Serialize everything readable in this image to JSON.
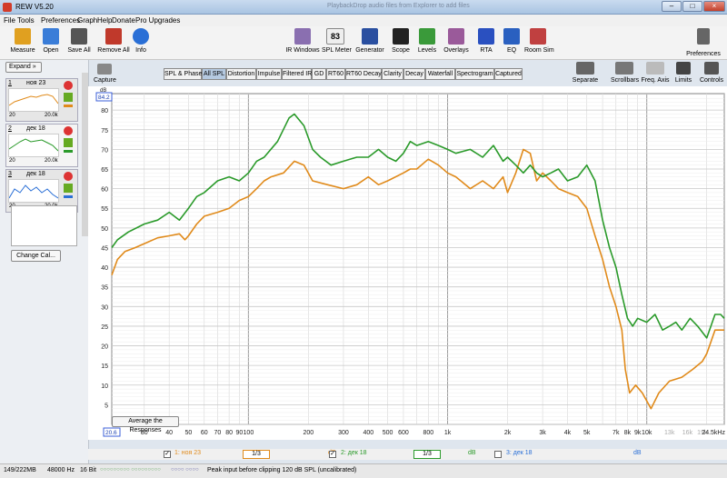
{
  "window": {
    "title": "REW V5.20",
    "blurred_title": "PlaybackDrop audio files from Explorer to add files"
  },
  "menu": [
    "File",
    "Tools",
    "Preferences",
    "Graph",
    "Help",
    "Donate",
    "Pro Upgrades"
  ],
  "toolbar": {
    "left": [
      {
        "label": "Measure",
        "icon": "microphone-icon",
        "color": "#e0a020"
      },
      {
        "label": "Open",
        "icon": "folder-icon",
        "color": "#3a7dd8"
      },
      {
        "label": "Save All",
        "icon": "floppy-icon",
        "color": "#555555"
      },
      {
        "label": "Remove All",
        "icon": "remove-icon",
        "color": "#c0392b"
      },
      {
        "label": "Info",
        "icon": "info-icon",
        "color": "#2a6fd6"
      }
    ],
    "center": [
      {
        "label": "IR Windows",
        "icon": "ir-windows-icon",
        "color": "#8a6fb0"
      },
      {
        "label": "SPL Meter",
        "icon": "spl-meter-icon",
        "value": "83",
        "unit": "dB SPL",
        "color": "#333333"
      },
      {
        "label": "Generator",
        "icon": "generator-icon",
        "color": "#2a4fa0"
      },
      {
        "label": "Scope",
        "icon": "scope-icon",
        "color": "#222222"
      },
      {
        "label": "Levels",
        "icon": "levels-icon",
        "color": "#3a9a3a"
      },
      {
        "label": "Overlays",
        "icon": "overlays-icon",
        "color": "#9a5a9a"
      },
      {
        "label": "RTA",
        "icon": "rta-icon",
        "color": "#2a50c0"
      },
      {
        "label": "EQ",
        "icon": "eq-icon",
        "color": "#2a60c0"
      },
      {
        "label": "Room Sim",
        "icon": "room-sim-icon",
        "color": "#c04040"
      }
    ],
    "preferences": {
      "label": "Preferences",
      "icon": "wrench-icon"
    }
  },
  "left_panel": {
    "expand_label": "Expand",
    "measurements": [
      {
        "num": "1",
        "date": "ноя 23",
        "color": "#e08a1a",
        "axis_start": "20",
        "axis_end": "20.0k"
      },
      {
        "num": "2",
        "date": "дек 18",
        "color": "#2a9a2a",
        "axis_start": "20",
        "axis_end": "20.0k"
      },
      {
        "num": "3",
        "date": "дек 18",
        "color": "#2a6fd6",
        "axis_start": "20",
        "axis_end": "20.0k"
      }
    ],
    "change_cal_label": "Change Cal..."
  },
  "capture_label": "Capture",
  "tabs": [
    "SPL & Phase",
    "All SPL",
    "Distortion",
    "Impulse",
    "Filtered IR",
    "GD",
    "RT60",
    "RT60 Decay",
    "Clarity",
    "Decay",
    "Waterfall",
    "Spectrogram",
    "Captured"
  ],
  "active_tab": "All SPL",
  "right_tools": [
    {
      "label": "Separate",
      "icon": "separate-icon"
    },
    {
      "label": "Scrollbars",
      "icon": "scrollbars-icon"
    },
    {
      "label": "Freq. Axis",
      "icon": "freq-axis-icon"
    },
    {
      "label": "Limits",
      "icon": "limits-icon"
    },
    {
      "label": "Controls",
      "icon": "controls-icon"
    }
  ],
  "graph": {
    "y_unit": "dB",
    "y_top_box": "84.2",
    "x_start_box": "20.6",
    "x_end_label": "24.5kHz",
    "average_button": "Average the Responses"
  },
  "legend": {
    "items": [
      {
        "checked": true,
        "name": "1: ноя 23",
        "smoothing": "1/3",
        "unit": "dB",
        "color": "#e08a1a"
      },
      {
        "checked": true,
        "name": "2: дек 18",
        "smoothing": "1/3",
        "unit": "dB",
        "color": "#2a9a2a"
      },
      {
        "checked": false,
        "name": "3: дек 18",
        "smoothing": "",
        "unit": "dB",
        "color": "#2a6fd6"
      }
    ]
  },
  "status": {
    "memory": "149/222MB",
    "sample_rate": "48000 Hz",
    "bits": "16 Bit",
    "clip_warning": "Peak input before clipping 120 dB SPL (uncalibrated)"
  },
  "chart_data": {
    "type": "line",
    "title": "",
    "xlabel": "",
    "ylabel": "dB",
    "x_scale": "log",
    "xlim": [
      20.6,
      24500
    ],
    "ylim": [
      0,
      84.2
    ],
    "grid": true,
    "x_tick_labels": [
      {
        "f": 20.6,
        "label": "20.6",
        "dim": false
      },
      {
        "f": 30,
        "label": "30",
        "dim": false
      },
      {
        "f": 40,
        "label": "40",
        "dim": false
      },
      {
        "f": 50,
        "label": "50",
        "dim": false
      },
      {
        "f": 60,
        "label": "60",
        "dim": false
      },
      {
        "f": 70,
        "label": "70",
        "dim": false
      },
      {
        "f": 80,
        "label": "80",
        "dim": false
      },
      {
        "f": 90,
        "label": "90",
        "dim": false
      },
      {
        "f": 100,
        "label": "100",
        "dim": false
      },
      {
        "f": 200,
        "label": "200",
        "dim": false
      },
      {
        "f": 300,
        "label": "300",
        "dim": false
      },
      {
        "f": 400,
        "label": "400",
        "dim": false
      },
      {
        "f": 500,
        "label": "500",
        "dim": false
      },
      {
        "f": 600,
        "label": "600",
        "dim": false
      },
      {
        "f": 800,
        "label": "800",
        "dim": false
      },
      {
        "f": 1000,
        "label": "1k",
        "dim": false
      },
      {
        "f": 2000,
        "label": "2k",
        "dim": false
      },
      {
        "f": 3000,
        "label": "3k",
        "dim": false
      },
      {
        "f": 4000,
        "label": "4k",
        "dim": false
      },
      {
        "f": 5000,
        "label": "5k",
        "dim": false
      },
      {
        "f": 7000,
        "label": "7k",
        "dim": false
      },
      {
        "f": 8000,
        "label": "8k",
        "dim": false
      },
      {
        "f": 9000,
        "label": "9k",
        "dim": false
      },
      {
        "f": 10000,
        "label": "10k",
        "dim": false
      },
      {
        "f": 13000,
        "label": "13k",
        "dim": true
      },
      {
        "f": 16000,
        "label": "16k",
        "dim": true
      },
      {
        "f": 19000,
        "label": "19k",
        "dim": true
      },
      {
        "f": 24500,
        "label": "24.5kHz",
        "dim": false
      }
    ],
    "y_ticks": [
      80,
      75,
      70,
      65,
      60,
      55,
      50,
      45,
      40,
      35,
      30,
      25,
      20,
      15,
      10,
      5
    ],
    "series": [
      {
        "name": "1: ноя 23",
        "color": "#e08a1a",
        "points": [
          [
            20.6,
            38
          ],
          [
            22,
            42
          ],
          [
            24,
            44
          ],
          [
            27,
            45
          ],
          [
            30,
            46
          ],
          [
            35,
            47.5
          ],
          [
            40,
            48
          ],
          [
            45,
            48.5
          ],
          [
            48,
            47
          ],
          [
            50,
            48
          ],
          [
            55,
            51
          ],
          [
            60,
            53
          ],
          [
            70,
            54
          ],
          [
            80,
            55
          ],
          [
            90,
            57
          ],
          [
            100,
            58
          ],
          [
            110,
            60
          ],
          [
            120,
            62
          ],
          [
            130,
            63
          ],
          [
            150,
            64
          ],
          [
            170,
            67
          ],
          [
            190,
            66
          ],
          [
            210,
            62
          ],
          [
            250,
            61
          ],
          [
            300,
            60
          ],
          [
            350,
            61
          ],
          [
            400,
            63
          ],
          [
            450,
            61
          ],
          [
            500,
            62
          ],
          [
            600,
            64
          ],
          [
            650,
            65
          ],
          [
            700,
            65
          ],
          [
            800,
            67.5
          ],
          [
            900,
            66
          ],
          [
            1000,
            64
          ],
          [
            1100,
            63
          ],
          [
            1300,
            60
          ],
          [
            1500,
            62
          ],
          [
            1700,
            60
          ],
          [
            1900,
            63
          ],
          [
            2000,
            59
          ],
          [
            2200,
            64
          ],
          [
            2400,
            70
          ],
          [
            2600,
            69
          ],
          [
            2800,
            62
          ],
          [
            3000,
            64
          ],
          [
            3300,
            62
          ],
          [
            3600,
            60
          ],
          [
            4000,
            59
          ],
          [
            4500,
            58
          ],
          [
            5000,
            55
          ],
          [
            5500,
            48
          ],
          [
            6000,
            42
          ],
          [
            6500,
            35
          ],
          [
            7000,
            30
          ],
          [
            7500,
            24
          ],
          [
            7800,
            14
          ],
          [
            8200,
            8
          ],
          [
            8800,
            10
          ],
          [
            9500,
            8
          ],
          [
            10500,
            4
          ],
          [
            11500,
            8
          ],
          [
            13000,
            11
          ],
          [
            15000,
            12
          ],
          [
            17000,
            14
          ],
          [
            19000,
            16
          ],
          [
            20000,
            18
          ],
          [
            21000,
            21
          ],
          [
            22000,
            24
          ],
          [
            23500,
            24
          ],
          [
            24500,
            24
          ]
        ]
      },
      {
        "name": "2: дек 18",
        "color": "#2a9a2a",
        "points": [
          [
            20.6,
            45
          ],
          [
            22,
            47
          ],
          [
            25,
            49
          ],
          [
            30,
            51
          ],
          [
            35,
            52
          ],
          [
            40,
            54
          ],
          [
            45,
            52
          ],
          [
            50,
            55
          ],
          [
            55,
            58
          ],
          [
            60,
            59
          ],
          [
            70,
            62
          ],
          [
            80,
            63
          ],
          [
            90,
            62
          ],
          [
            100,
            64
          ],
          [
            110,
            67
          ],
          [
            120,
            68
          ],
          [
            140,
            72
          ],
          [
            160,
            78
          ],
          [
            170,
            79
          ],
          [
            190,
            76
          ],
          [
            210,
            70
          ],
          [
            230,
            68
          ],
          [
            260,
            66
          ],
          [
            300,
            67
          ],
          [
            350,
            68
          ],
          [
            400,
            68
          ],
          [
            450,
            70
          ],
          [
            500,
            68
          ],
          [
            550,
            67
          ],
          [
            600,
            69
          ],
          [
            650,
            72
          ],
          [
            700,
            71
          ],
          [
            800,
            72
          ],
          [
            900,
            71
          ],
          [
            1000,
            70
          ],
          [
            1100,
            69
          ],
          [
            1300,
            70
          ],
          [
            1500,
            68
          ],
          [
            1700,
            71
          ],
          [
            1900,
            67
          ],
          [
            2000,
            68
          ],
          [
            2200,
            66
          ],
          [
            2400,
            64
          ],
          [
            2600,
            66
          ],
          [
            2800,
            64
          ],
          [
            3000,
            63
          ],
          [
            3300,
            64
          ],
          [
            3600,
            65
          ],
          [
            4000,
            62
          ],
          [
            4500,
            63
          ],
          [
            5000,
            66
          ],
          [
            5500,
            62
          ],
          [
            6000,
            52
          ],
          [
            6500,
            45
          ],
          [
            7000,
            40
          ],
          [
            7500,
            33
          ],
          [
            8000,
            27
          ],
          [
            8500,
            25
          ],
          [
            9000,
            27
          ],
          [
            10000,
            26
          ],
          [
            11000,
            28
          ],
          [
            12000,
            24
          ],
          [
            13000,
            25
          ],
          [
            14000,
            26
          ],
          [
            15000,
            24
          ],
          [
            16500,
            27
          ],
          [
            18000,
            25
          ],
          [
            20000,
            22
          ],
          [
            21000,
            25
          ],
          [
            22000,
            28
          ],
          [
            23500,
            28
          ],
          [
            24500,
            27
          ]
        ]
      }
    ]
  }
}
